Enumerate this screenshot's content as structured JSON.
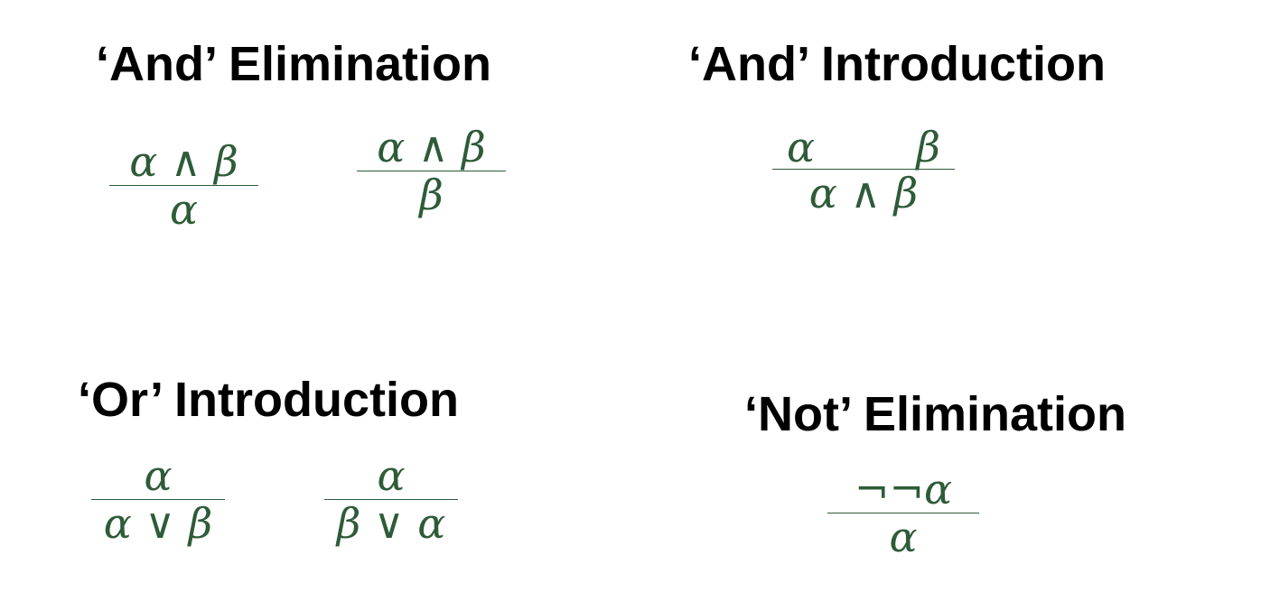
{
  "sections": {
    "and_elim": {
      "title": "‘And’ Elimination",
      "rules": [
        {
          "premise": "α ∧ β",
          "conclusion": "α"
        },
        {
          "premise": "α ∧ β",
          "conclusion": "β"
        }
      ]
    },
    "and_intro": {
      "title": "‘And’ Introduction",
      "rule": {
        "premise_left": "α",
        "premise_right": "β",
        "conclusion": "α ∧ β"
      }
    },
    "or_intro": {
      "title": "‘Or’ Introduction",
      "rules": [
        {
          "premise": "α",
          "conclusion": "α ∨ β"
        },
        {
          "premise": "α",
          "conclusion": "β ∨ α"
        }
      ]
    },
    "not_elim": {
      "title": "‘Not’ Elimination",
      "rule": {
        "premise": "¬¬α",
        "conclusion": "α"
      }
    }
  },
  "colors": {
    "heading": "#000000",
    "formula": "#2e5b38"
  }
}
